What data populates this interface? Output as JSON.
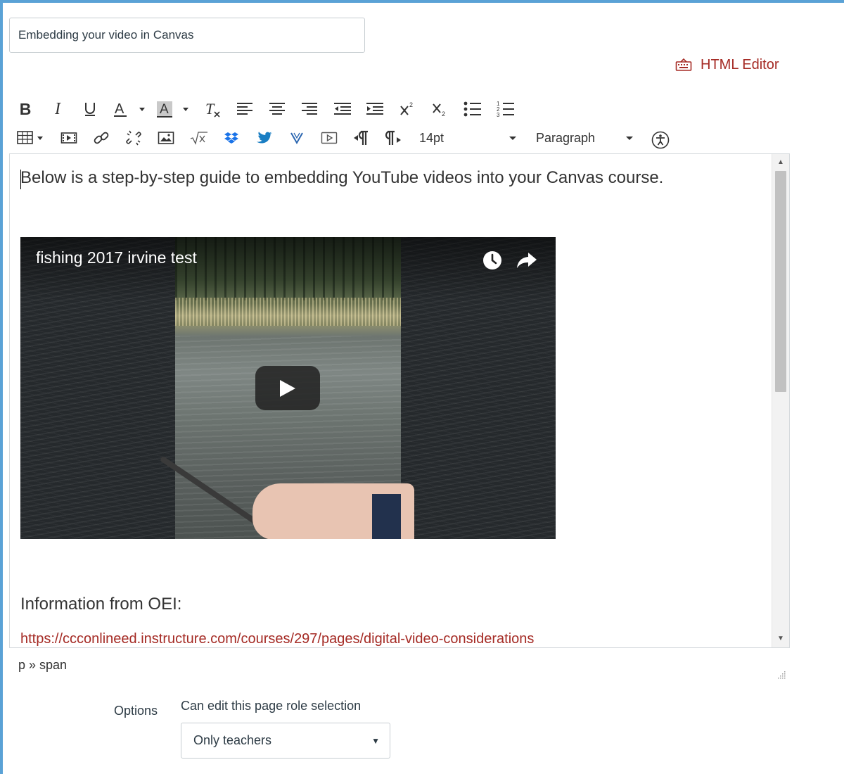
{
  "page_title_input": {
    "value": "Embedding your video in Canvas"
  },
  "html_editor": {
    "label": "HTML Editor"
  },
  "toolbar": {
    "font_size": "14pt",
    "block_format": "Paragraph"
  },
  "editor": {
    "intro": "Below is a step-by-step guide to embedding YouTube videos into your Canvas course.",
    "video": {
      "title": "fishing 2017 irvine test"
    },
    "info_heading": "Information from OEI:",
    "info_link": "https://ccconlineed.instructure.com/courses/297/pages/digital-video-considerations"
  },
  "status_path": "p » span",
  "options": {
    "label": "Options",
    "role_label": "Can edit this page role selection",
    "role_value": "Only teachers"
  },
  "colors": {
    "accent_link": "#a52b25",
    "frame": "#5aa2d6"
  }
}
